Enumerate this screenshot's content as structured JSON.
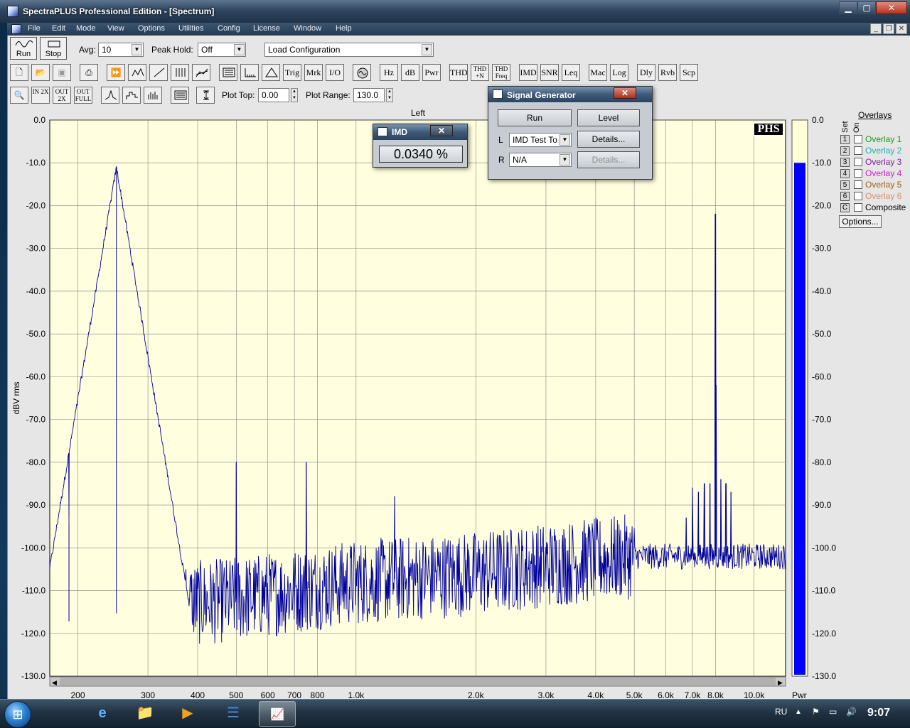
{
  "window": {
    "title": "SpectraPLUS Professional Edition - [Spectrum]",
    "controls": {
      "minimize": "▁",
      "maximize": "▢",
      "close": "✕"
    },
    "mdi_controls": {
      "minimize": "_",
      "restore": "❐",
      "close": "✕"
    }
  },
  "menu": [
    "File",
    "Edit",
    "Mode",
    "View",
    "Options",
    "Utilities",
    "Config",
    "License",
    "Window",
    "Help"
  ],
  "toolbar1": {
    "run_label": "Run",
    "stop_label": "Stop",
    "avg_label": "Avg:",
    "avg_value": "10",
    "peak_hold_label": "Peak Hold:",
    "peak_hold_value": "Off",
    "load_config_value": "Load Configuration"
  },
  "toolbar2": {
    "text_buttons": [
      "Trig",
      "Mrk",
      "I/O",
      "Hz",
      "dB",
      "Pwr",
      "THD",
      "THD +N",
      "THD Freq",
      "IMD",
      "SNR",
      "Leq",
      "Mac",
      "Log",
      "Dly",
      "Rvb",
      "Scp"
    ]
  },
  "toolbar3": {
    "zoom_buttons": [
      "IN 2X",
      "OUT 2X",
      "OUT FULL"
    ],
    "plot_top_label": "Plot Top:",
    "plot_top_value": "0.00",
    "plot_range_label": "Plot Range:",
    "plot_range_value": "130.0"
  },
  "plot": {
    "channel_title": "Left",
    "badge": "PHS",
    "meter_label": "Pwr"
  },
  "overlays": {
    "header": "Overlays",
    "set_label": "Set",
    "on_label": "On",
    "items": [
      {
        "num": "1",
        "name": "Overlay 1",
        "color": "#1a9a1a"
      },
      {
        "num": "2",
        "name": "Overlay 2",
        "color": "#20b0b0"
      },
      {
        "num": "3",
        "name": "Overlay 3",
        "color": "#7a20a0"
      },
      {
        "num": "4",
        "name": "Overlay 4",
        "color": "#d020d0"
      },
      {
        "num": "5",
        "name": "Overlay 5",
        "color": "#a06010"
      },
      {
        "num": "6",
        "name": "Overlay 6",
        "color": "#e09060"
      },
      {
        "num": "C",
        "name": "Composite",
        "color": "#000000"
      }
    ],
    "options_label": "Options..."
  },
  "imd_window": {
    "title": "IMD",
    "value": "0.0340 %"
  },
  "signal_generator": {
    "title": "Signal Generator",
    "run_label": "Run",
    "level_label": "Level",
    "left_label": "L",
    "left_value": "IMD Test To",
    "left_details": "Details...",
    "right_label": "R",
    "right_value": "N/A",
    "right_details": "Details..."
  },
  "chart_data": {
    "type": "line",
    "title": "Left",
    "xlabel": "",
    "ylabel": "dBV rms",
    "x_scale": "log",
    "xlim": [
      170,
      12000
    ],
    "ylim": [
      -130,
      0
    ],
    "y_ticks": [
      0,
      -10,
      -20,
      -30,
      -40,
      -50,
      -60,
      -70,
      -80,
      -90,
      -100,
      -110,
      -120,
      -130
    ],
    "y_tick_labels": [
      "0.0",
      "-10.0",
      "-20.0",
      "-30.0",
      "-40.0",
      "-50.0",
      "-60.0",
      "-70.0",
      "-80.0",
      "-90.0",
      "-100.0",
      "-110.0",
      "-120.0",
      "-130.0"
    ],
    "x_ticks": [
      200,
      300,
      400,
      500,
      600,
      700,
      800,
      1000,
      2000,
      3000,
      4000,
      5000,
      6000,
      7000,
      8000,
      10000
    ],
    "x_tick_labels": [
      "200",
      "300",
      "400",
      "500",
      "600",
      "700",
      "800",
      "1.0k",
      "2.0k",
      "3.0k",
      "4.0k",
      "5.0k",
      "6.0k",
      "7.0k",
      "8.0k",
      "10.0k"
    ],
    "grid": true,
    "line_color": "#0000a0",
    "background_color": "#ffffe0",
    "noise_floor": [
      {
        "f": 170,
        "db": -118
      },
      {
        "f": 300,
        "db": -114
      },
      {
        "f": 500,
        "db": -112
      },
      {
        "f": 1000,
        "db": -108
      },
      {
        "f": 2000,
        "db": -106
      },
      {
        "f": 3000,
        "db": -104
      },
      {
        "f": 5000,
        "db": -102
      },
      {
        "f": 12000,
        "db": -102
      }
    ],
    "peaks": [
      {
        "f": 250,
        "db": -11
      },
      {
        "f": 190,
        "db": -94
      },
      {
        "f": 500,
        "db": -80
      },
      {
        "f": 750,
        "db": -80
      },
      {
        "f": 1250,
        "db": -88
      },
      {
        "f": 7000,
        "db": -86
      },
      {
        "f": 7250,
        "db": -87
      },
      {
        "f": 7500,
        "db": -85
      },
      {
        "f": 7750,
        "db": -85
      },
      {
        "f": 8000,
        "db": -22
      },
      {
        "f": 8020,
        "db": -62
      },
      {
        "f": 8250,
        "db": -84
      },
      {
        "f": 8500,
        "db": -85
      },
      {
        "f": 8750,
        "db": -87
      },
      {
        "f": 6750,
        "db": -93
      }
    ],
    "power_meter": {
      "min_db": -130,
      "max_db": 0,
      "level_db": -10,
      "color": "#0000ff"
    }
  },
  "taskbar": {
    "lang": "RU",
    "clock": "9:07"
  }
}
